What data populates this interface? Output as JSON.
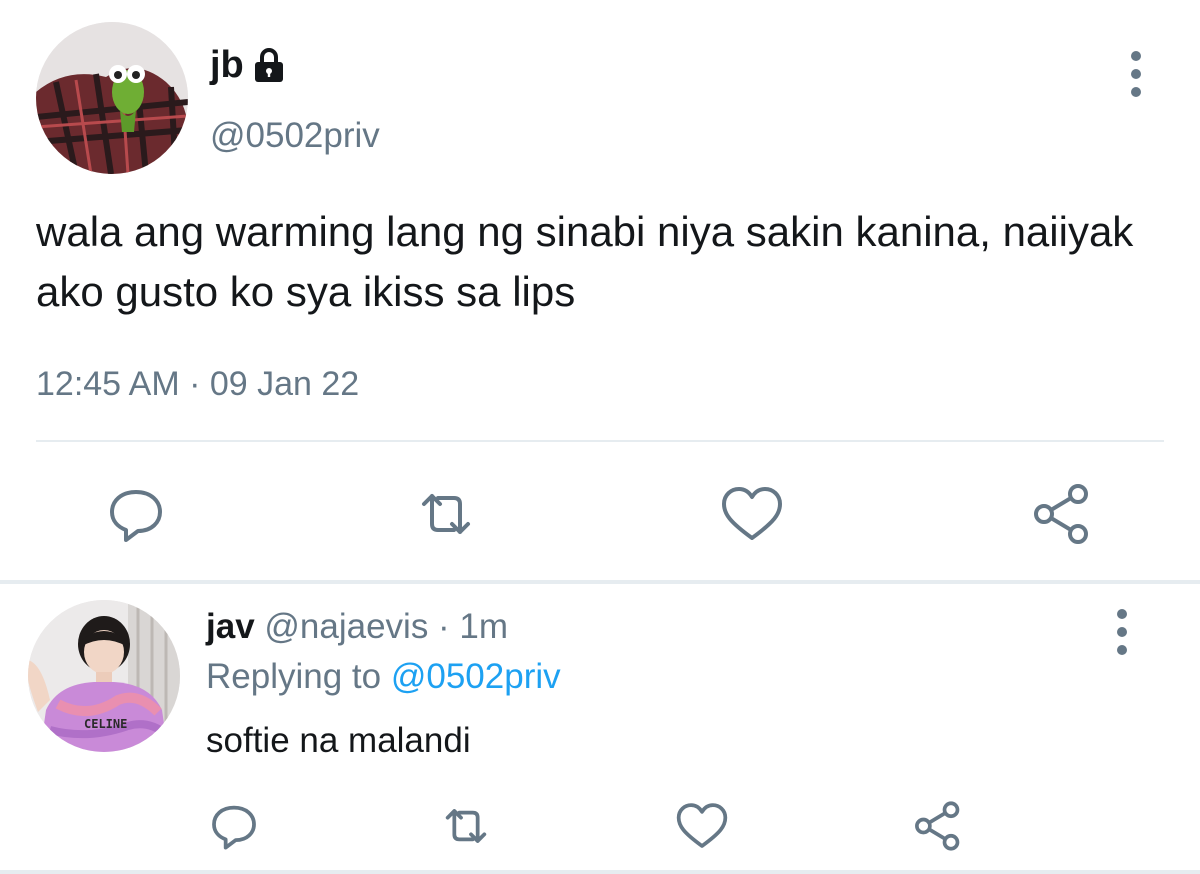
{
  "tweet": {
    "author": {
      "name": "jb",
      "handle": "@0502priv",
      "protected": true,
      "avatar_icon": "avatar-plush-frog"
    },
    "text": "wala ang warming lang ng sinabi niya sakin kanina, naiiyak ako gusto ko sya ikiss sa lips",
    "timestamp": "12:45 AM · 09 Jan 22",
    "actions": [
      "reply-icon",
      "retweet-icon",
      "like-icon",
      "share-icon"
    ]
  },
  "reply": {
    "author": {
      "name": "jav",
      "meta": "@najaevis · 1m",
      "avatar_icon": "avatar-person"
    },
    "replying_prefix": "Replying to",
    "replying_to": "@0502priv",
    "text": "softie na malandi",
    "actions": [
      "reply-icon",
      "retweet-icon",
      "like-icon",
      "share-icon"
    ]
  },
  "colors": {
    "text": "#14171a",
    "secondary": "#657786",
    "link": "#1da1f2",
    "divider": "#e6ecf0"
  }
}
